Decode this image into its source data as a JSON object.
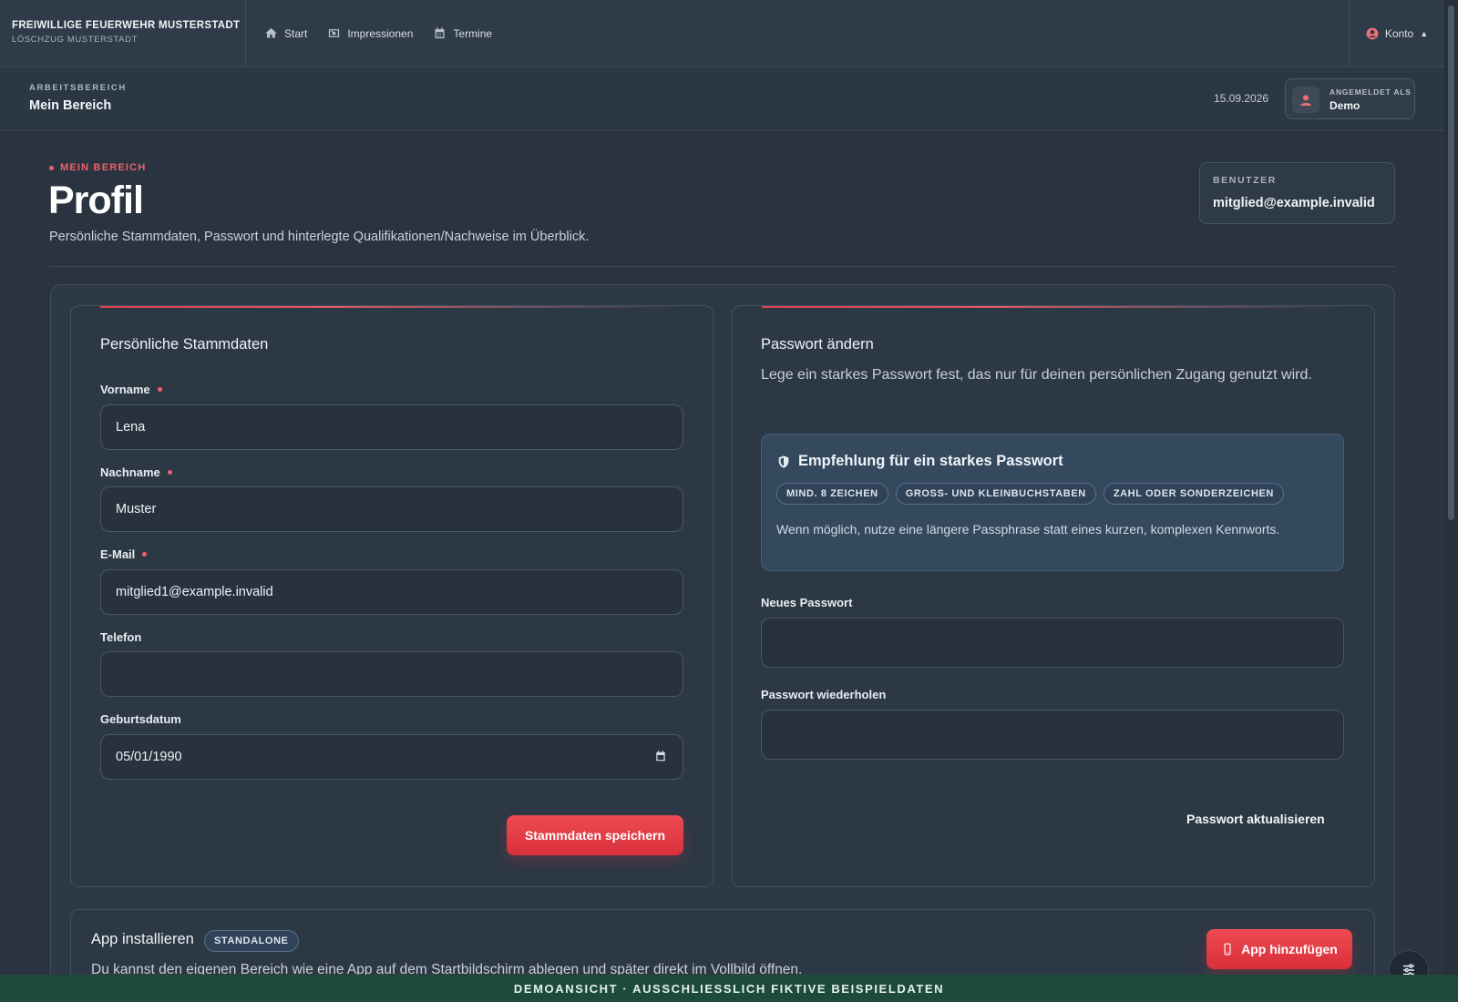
{
  "brand": {
    "title": "FREIWILLIGE FEUERWEHR MUSTERSTADT",
    "subtitle": "LÖSCHZUG MUSTERSTADT"
  },
  "nav": [
    {
      "label": "Start",
      "icon": "home-icon"
    },
    {
      "label": "Impressionen",
      "icon": "photo-icon"
    },
    {
      "label": "Termine",
      "icon": "calendar-icon"
    }
  ],
  "account": {
    "label": "Konto",
    "icon": "user-circle-icon",
    "chevron": "chevron-up-icon"
  },
  "subheader": {
    "eyebrow": "ARBEITSBEREICH",
    "title": "Mein Bereich",
    "date": "15.09.2026",
    "login_label": "ANGEMELDET ALS",
    "login_name": "Demo"
  },
  "page": {
    "eyebrow": "MEIN BEREICH",
    "title": "Profil",
    "description": "Persönliche Stammdaten, Passwort und hinterlegte Qualifikationen/Nachweise im Überblick.",
    "user_label": "BENUTZER",
    "user_value": "mitglied@example.invalid"
  },
  "stammdaten": {
    "title": "Persönliche Stammdaten",
    "fields": {
      "vorname": {
        "label": "Vorname",
        "value": "Lena",
        "required": true
      },
      "nachname": {
        "label": "Nachname",
        "value": "Muster",
        "required": true
      },
      "email": {
        "label": "E-Mail",
        "value": "mitglied1@example.invalid",
        "required": true
      },
      "telefon": {
        "label": "Telefon",
        "value": "",
        "required": false
      },
      "geburtsdatum": {
        "label": "Geburtsdatum",
        "value": "05/01/1990",
        "required": false
      }
    },
    "save_label": "Stammdaten speichern"
  },
  "passwort": {
    "title": "Passwort ändern",
    "description": "Lege ein starkes Passwort fest, das nur für deinen persönlichen Zugang genutzt wird.",
    "recommendation": {
      "title": "Empfehlung für ein starkes Passwort",
      "chips": [
        "MIND. 8 ZEICHEN",
        "GROSS- UND KLEINBUCHSTABEN",
        "ZAHL ODER SONDERZEICHEN"
      ],
      "note": "Wenn möglich, nutze eine längere Passphrase statt eines kurzen, komplexen Kennworts."
    },
    "new_label": "Neues Passwort",
    "repeat_label": "Passwort wiederholen",
    "submit_label": "Passwort aktualisieren"
  },
  "app": {
    "title": "App installieren",
    "badge": "STANDALONE",
    "description": "Du kannst den eigenen Bereich wie eine App auf dem Startbildschirm ablegen und später direkt im Vollbild öffnen.",
    "button_label": "App hinzufügen"
  },
  "demo_bar": "DEMOANSICHT · AUSSCHLIESSLICH FIKTIVE BEISPIELDATEN",
  "colors": {
    "accent": "#ef4a52",
    "background": "#2a3440",
    "demo_bar": "#1d4a3a"
  }
}
